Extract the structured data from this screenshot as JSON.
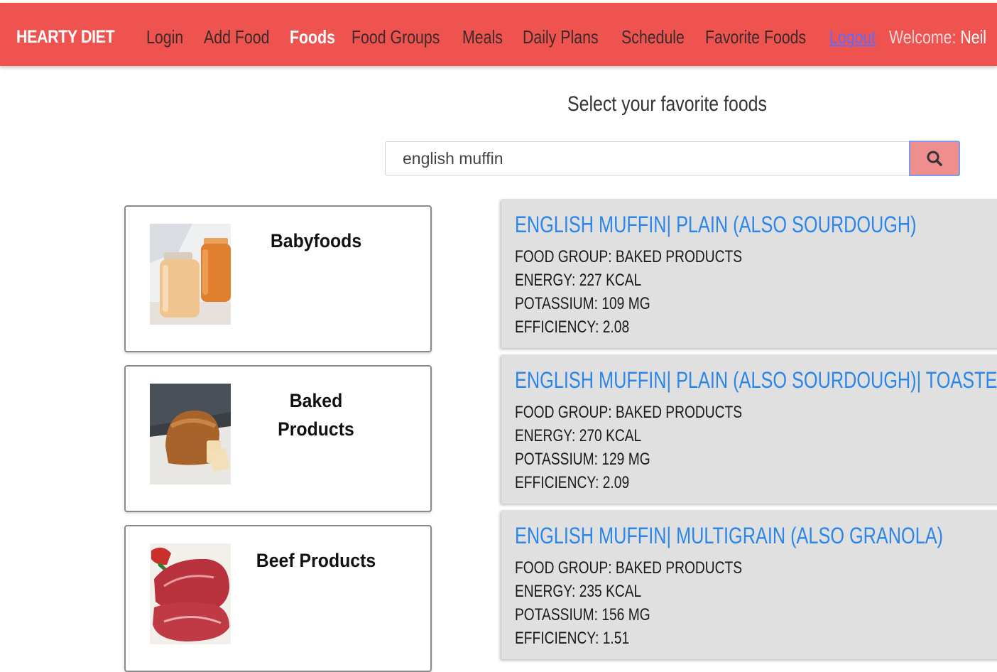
{
  "navbar": {
    "brand": "HEARTY DIET",
    "links": [
      "Login",
      "Add Food",
      "Foods",
      "Food Groups",
      "Meals",
      "Daily Plans",
      "Schedule",
      "Favorite Foods"
    ],
    "active": "Foods",
    "logout": "Logout",
    "welcome_label": "Welcome:",
    "user_name": "Neil",
    "colors": {
      "bar": "#ef5350",
      "active_link": "#ffffff",
      "logout": "#5b6cff"
    }
  },
  "page": {
    "title": "Select your favorite foods"
  },
  "search": {
    "value": "english muffin",
    "button_icon": "search-icon"
  },
  "food_groups": [
    {
      "name": "Babyfoods",
      "image": "baby-food-jars-photo"
    },
    {
      "name": "Baked Products",
      "image": "bread-loaf-photo"
    },
    {
      "name": "Beef Products",
      "image": "raw-steak-photo"
    }
  ],
  "results": [
    {
      "title": "ENGLISH MUFFIN| PLAIN (ALSO SOURDOUGH)",
      "food_group": "FOOD GROUP: BAKED PRODUCTS",
      "energy": "ENERGY: 227 KCAL",
      "potassium": "POTASSIUM: 109 MG",
      "efficiency": "EFFICIENCY: 2.08"
    },
    {
      "title": "ENGLISH MUFFIN| PLAIN (ALSO SOURDOUGH)| TOASTED",
      "food_group": "FOOD GROUP: BAKED PRODUCTS",
      "energy": "ENERGY: 270 KCAL",
      "potassium": "POTASSIUM: 129 MG",
      "efficiency": "EFFICIENCY: 2.09"
    },
    {
      "title": "ENGLISH MUFFIN| MULTIGRAIN (ALSO GRANOLA)",
      "food_group": "FOOD GROUP: BAKED PRODUCTS",
      "energy": "ENERGY: 235 KCAL",
      "potassium": "POTASSIUM: 156 MG",
      "efficiency": "EFFICIENCY: 1.51"
    }
  ]
}
